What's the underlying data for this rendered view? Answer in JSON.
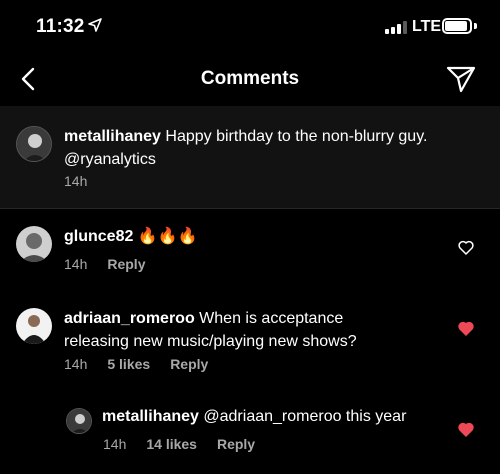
{
  "status_bar": {
    "time": "11:32",
    "network": "LTE"
  },
  "header": {
    "title": "Comments"
  },
  "caption": {
    "username": "metallihaney",
    "text": "Happy birthday to the non-blurry guy.",
    "mention": "@ryanalytics",
    "age": "14h"
  },
  "comments": [
    {
      "username": "glunce82",
      "text": "🔥🔥🔥",
      "age": "14h",
      "reply": "Reply",
      "liked": false,
      "heart_color": "#ffffff"
    },
    {
      "username": "adriaan_romeroo",
      "text": "When is acceptance",
      "text_line2": "releasing new music/playing new shows?",
      "age": "14h",
      "likes": "5 likes",
      "reply": "Reply",
      "liked": true,
      "heart_color": "#ed4956"
    },
    {
      "username": "metallihaney",
      "text": "@adriaan_romeroo this year",
      "age": "14h",
      "likes": "14 likes",
      "reply": "Reply",
      "liked": true,
      "heart_color": "#ed4956",
      "is_reply": true
    }
  ],
  "colors": {
    "background": "#000000",
    "caption_background": "#121212",
    "meta_text": "#a8a8a8",
    "like_red": "#ed4956"
  }
}
